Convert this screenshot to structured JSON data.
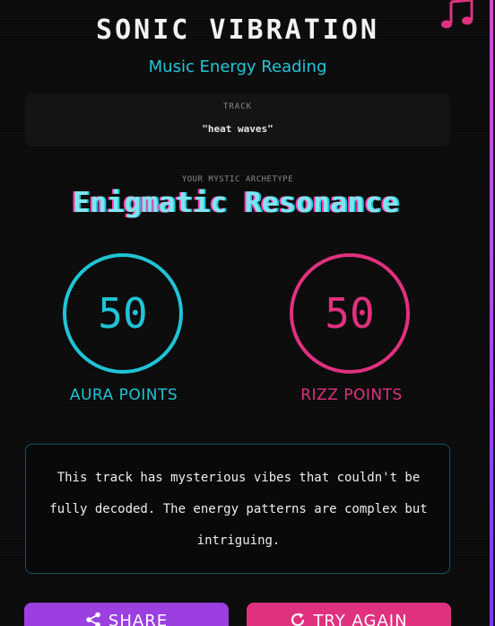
{
  "header": {
    "title": "SONIC VIBRATION",
    "subtitle": "Music Energy Reading",
    "icon": "music-note-icon",
    "icon_color": "#e0317f"
  },
  "track": {
    "label": "TRACK",
    "name": "\"heat waves\""
  },
  "archetype": {
    "label": "YOUR MYSTIC ARCHETYPE",
    "name": "Enigmatic Resonance"
  },
  "scores": {
    "aura": {
      "value": "50",
      "label": "AURA POINTS",
      "color": "#1fc4d6"
    },
    "rizz": {
      "value": "50",
      "label": "RIZZ POINTS",
      "color": "#e0317f"
    }
  },
  "message": "This track has mysterious vibes that couldn't be fully decoded. The energy patterns are complex but intriguing.",
  "actions": {
    "share_label": "SHARE",
    "share_icon": "share-icon",
    "retry_label": "TRY AGAIN",
    "retry_icon": "refresh-icon"
  },
  "colors": {
    "background": "#0b0b0c",
    "cyan": "#1fc4d6",
    "pink": "#e0317f",
    "purple": "#9b3fe0"
  }
}
